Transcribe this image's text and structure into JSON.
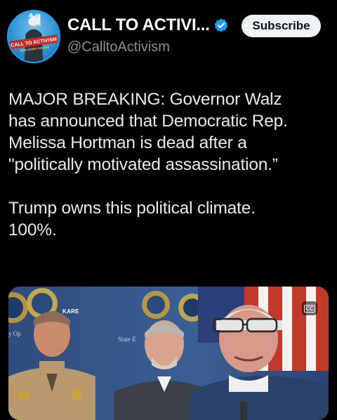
{
  "account": {
    "display_name": "CALL TO ACTIVI...",
    "handle": "@CalltoActivism",
    "avatar_text": "CALL TO ACTIVISM",
    "avatar_subtext": "WITH DEREK GALLINA",
    "verified_icon": "verified-badge-icon",
    "accent_color": "#1d9bf0"
  },
  "subscribe_label": "Subscribe",
  "post": {
    "lines": [
      "MAJOR BREAKING: Governor Walz",
      "has announced that Democratic Rep.",
      "Melissa Hortman is dead after a",
      "\"politically motivated assassination.”"
    ],
    "lines2": [
      "Trump owns this political climate.",
      "100%."
    ]
  },
  "media": {
    "watermark": "KARE",
    "cc_label": "CC",
    "bg_texts": [
      "State E",
      "y Op"
    ]
  }
}
